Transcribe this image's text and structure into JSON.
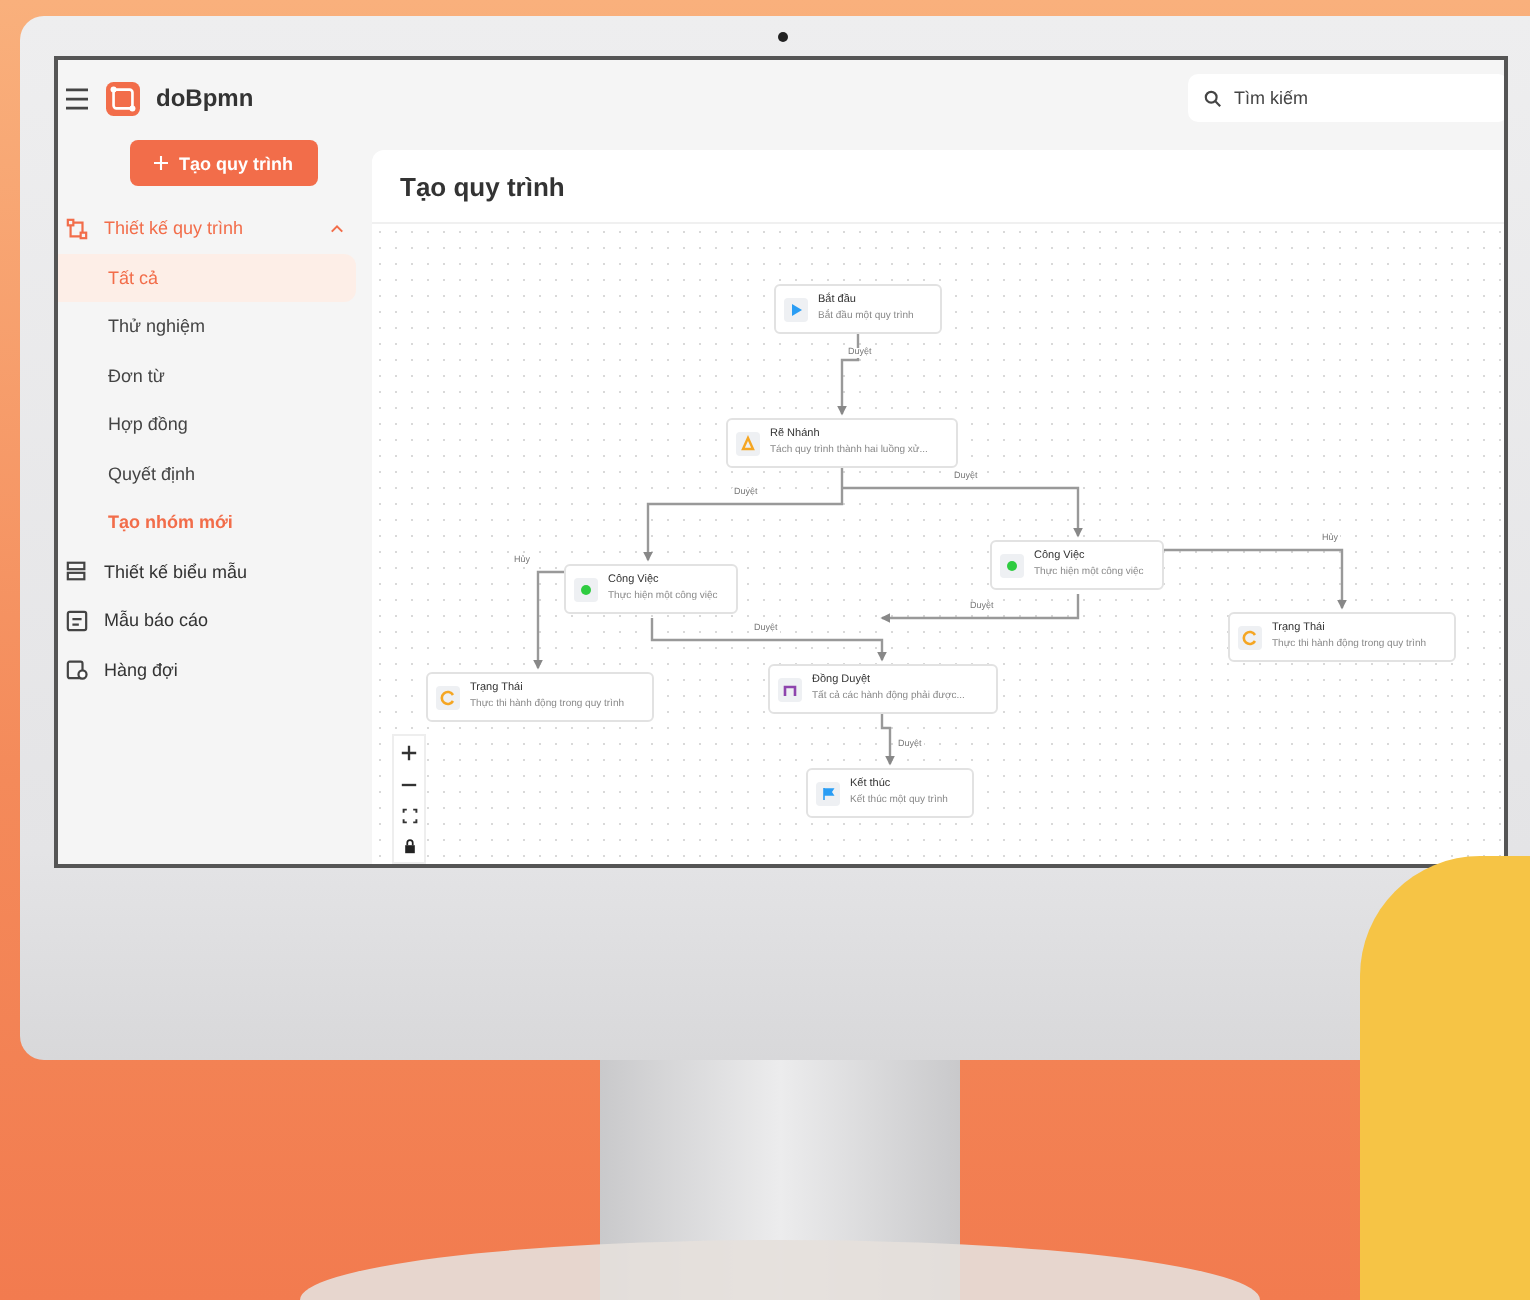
{
  "header": {
    "app_name": "doBpmn",
    "search": {
      "placeholder": "Tìm kiếm"
    }
  },
  "sidebar": {
    "create_button": {
      "label": "Tạo quy trình"
    },
    "items": [
      {
        "label": "Thiết kế quy trình",
        "selected": true,
        "expanded": true,
        "children": [
          {
            "label": "Tất cả",
            "kind": "link",
            "selected": true
          },
          {
            "label": "Thử nghiệm",
            "kind": "link",
            "selected": false
          },
          {
            "label": "Đơn từ",
            "kind": "link",
            "selected": false
          },
          {
            "label": "Hợp đồng",
            "kind": "link",
            "selected": false
          },
          {
            "label": "Quyết định",
            "kind": "link",
            "selected": false
          },
          {
            "label": "Tạo nhóm mới",
            "kind": "action",
            "selected": false
          }
        ]
      },
      {
        "label": "Thiết kế biểu mẫu",
        "selected": false
      },
      {
        "label": "Mẫu báo cáo",
        "selected": false
      },
      {
        "label": "Hàng đợi",
        "selected": false
      }
    ]
  },
  "main": {
    "title": "Tạo quy trình",
    "nodes": [
      {
        "kind": "start",
        "title": "Bắt đầu",
        "description": "Bắt đầu một quy trình"
      },
      {
        "kind": "branch",
        "title": "Rẽ Nhánh",
        "description": "Tách quy trình thành hai luồng xử..."
      },
      {
        "kind": "task",
        "title": "Công Việc",
        "description": "Thực hiện một công việc"
      },
      {
        "kind": "task",
        "title": "Công Việc",
        "description": "Thực hiện một công việc"
      },
      {
        "kind": "status",
        "title": "Trạng Thái",
        "description": "Thực thi hành động trong quy trình"
      },
      {
        "kind": "status",
        "title": "Trạng Thái",
        "description": "Thực thi hành động trong quy trình"
      },
      {
        "kind": "approval",
        "title": "Đồng Duyệt",
        "description": "Tất cả các hành động phải được..."
      },
      {
        "kind": "end",
        "title": "Kết thúc",
        "description": "Kết thúc một quy trình"
      }
    ],
    "edges": [
      {
        "label": "Duyệt"
      },
      {
        "label": "Duyệt"
      },
      {
        "label": "Duyệt"
      },
      {
        "label": "Hủy"
      },
      {
        "label": "Duyệt"
      },
      {
        "label": "Duyệt"
      },
      {
        "label": "Hủy"
      },
      {
        "label": "Duyệt"
      }
    ]
  }
}
